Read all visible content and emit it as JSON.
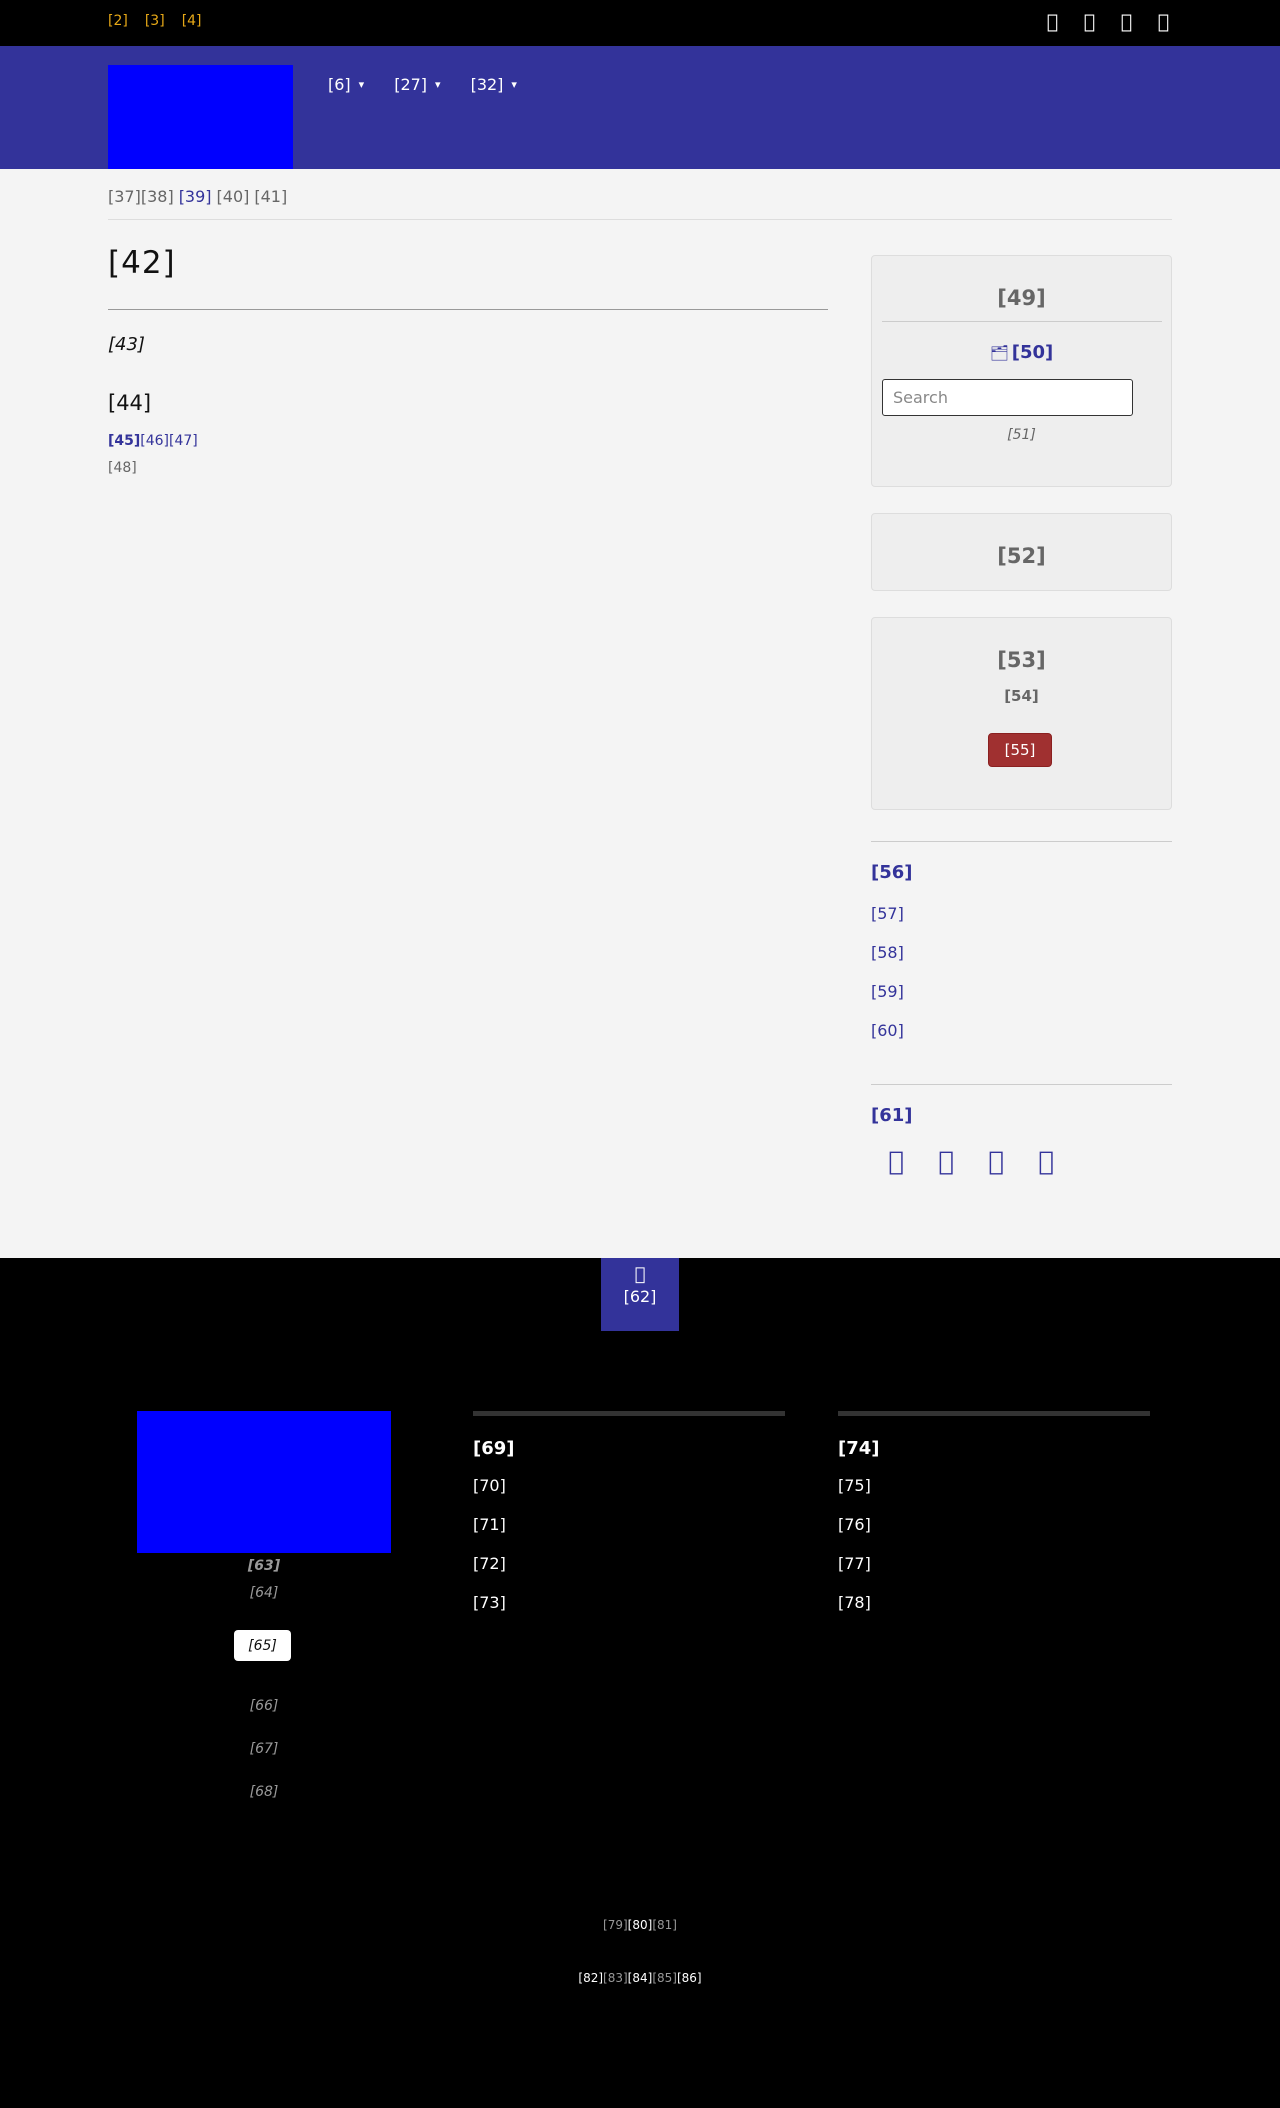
{
  "topbar": {
    "links": [
      "[2]",
      "[3]",
      "[4]"
    ],
    "icons": [
      "facebook-icon",
      "twitter-icon",
      "youtube-icon",
      "rss-icon"
    ]
  },
  "header": {
    "nav": [
      {
        "label": "[6]",
        "caret": "▾"
      },
      {
        "label": "[27]",
        "caret": "▾"
      },
      {
        "label": "[32]",
        "caret": "▾"
      }
    ]
  },
  "breadcrumb": [
    "[37]",
    "[38]",
    "[39]",
    "[40]",
    "[41]"
  ],
  "main": {
    "title": "[42]",
    "subtitle": "[43]",
    "section": "[44]",
    "tags": [
      "[45]",
      "[46]",
      "[47]"
    ],
    "meta": "[48]"
  },
  "sidebar": {
    "search_widget": {
      "title": "[49]",
      "link": "[50]",
      "placeholder": "Search",
      "note": "[51]"
    },
    "widget2": {
      "title": "[52]"
    },
    "widget3": {
      "title": "[53]",
      "subtitle": "[54]",
      "button": "[55]"
    },
    "links_section": {
      "title": "[56]",
      "items": [
        "[57]",
        "[58]",
        "[59]",
        "[60]"
      ]
    },
    "social_section": {
      "title": "[61]",
      "icons": [
        "facebook-icon",
        "twitter-icon",
        "youtube-icon",
        "rss-icon"
      ]
    }
  },
  "footer": {
    "back_to_top": "[62]",
    "tagline": "[63]",
    "sub": "[64]",
    "button": "[65]",
    "links": [
      "[66]",
      "[67]",
      "[68]"
    ],
    "col1": {
      "title": "[69]",
      "items": [
        "[70]",
        "[71]",
        "[72]",
        "[73]"
      ]
    },
    "col2": {
      "title": "[74]",
      "items": [
        "[75]",
        "[76]",
        "[77]",
        "[78]"
      ]
    },
    "row1": [
      "[79]",
      "[80]",
      "[81]"
    ],
    "row2": [
      "[82]",
      "[83]",
      "[84]",
      "[85]",
      "[86]"
    ]
  }
}
